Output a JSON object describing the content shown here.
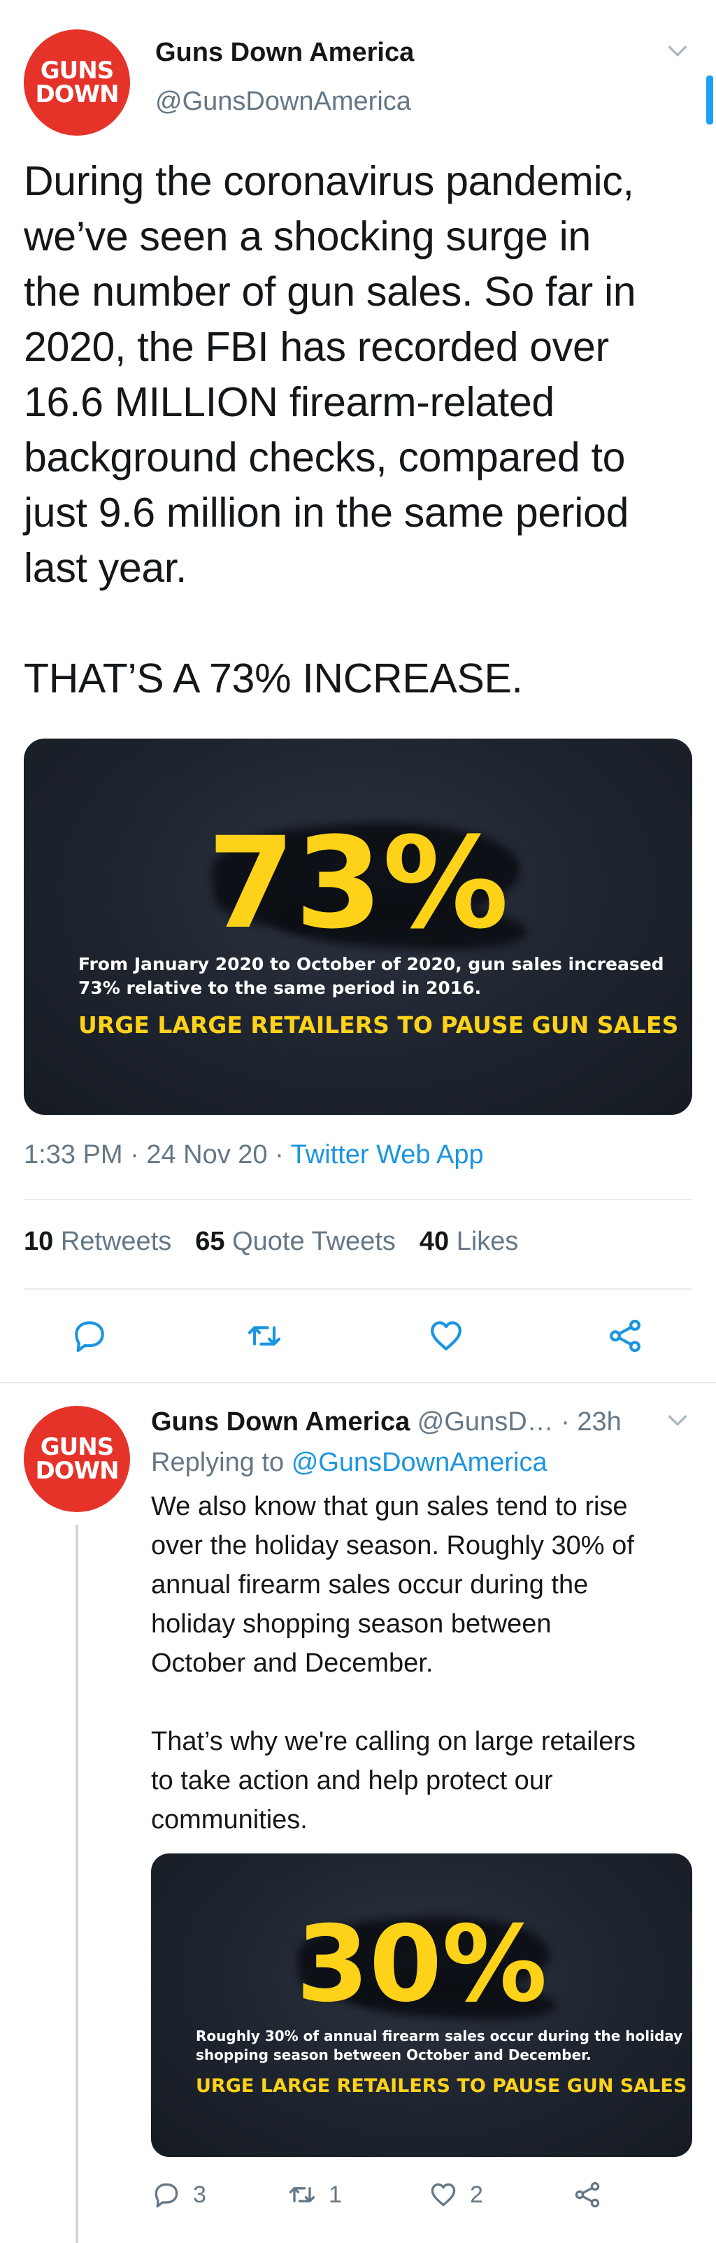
{
  "tweet": {
    "avatar": {
      "line1": "GUNS",
      "line2": "DOWN"
    },
    "display_name": "Guns Down America",
    "handle": "@GunsDownAmerica",
    "body": "During the coronavirus pandemic,\nwe’ve seen a shocking surge in\nthe number of gun sales. So far in\n2020, the FBI has recorded over\n16.6 MILLION firearm-related\nbackground checks, compared to\njust 9.6 million in the same period\nlast year.\n\nTHAT’S A 73% INCREASE.",
    "media": {
      "big_number": "73%",
      "caption_line1": "From January 2020 to October of 2020, gun sales increased",
      "caption_line2": "73% relative to the same period in 2016.",
      "cta": "URGE LARGE RETAILERS TO PAUSE GUN SALES"
    },
    "time": "1:33 PM",
    "date": "24 Nov 20",
    "source": "Twitter Web App",
    "stats": {
      "retweets_count": "10",
      "retweets_label": "Retweets",
      "quotes_count": "65",
      "quotes_label": "Quote Tweets",
      "likes_count": "40",
      "likes_label": "Likes"
    },
    "actions": [
      "reply-icon",
      "retweet-icon",
      "like-icon",
      "share-icon"
    ]
  },
  "reply": {
    "avatar": {
      "line1": "GUNS",
      "line2": "DOWN"
    },
    "display_name": "Guns Down America",
    "handle": "@GunsD…",
    "age": "· 23h",
    "replying_label": "Replying to",
    "replying_handle": "@GunsDownAmerica",
    "body": "We also know that gun sales tend to rise\nover the holiday season. Roughly 30% of\nannual firearm sales occur during the\nholiday shopping season between\nOctober and December.\n\nThat’s why we're calling on large retailers\nto take action and help protect our\ncommunities.",
    "media": {
      "big_number": "30%",
      "caption_line1": "Roughly 30% of annual firearm sales occur during the holiday",
      "caption_line2": "shopping season between October and December.",
      "cta": "URGE LARGE RETAILERS TO PAUSE GUN SALES"
    },
    "reply_count": "3",
    "retweet_count": "1",
    "like_count": "2"
  },
  "colors": {
    "brand_red": "#e5332a",
    "link_blue": "#1b95e0",
    "accent_yellow": "#ffd21a",
    "muted_gray": "#657786"
  }
}
